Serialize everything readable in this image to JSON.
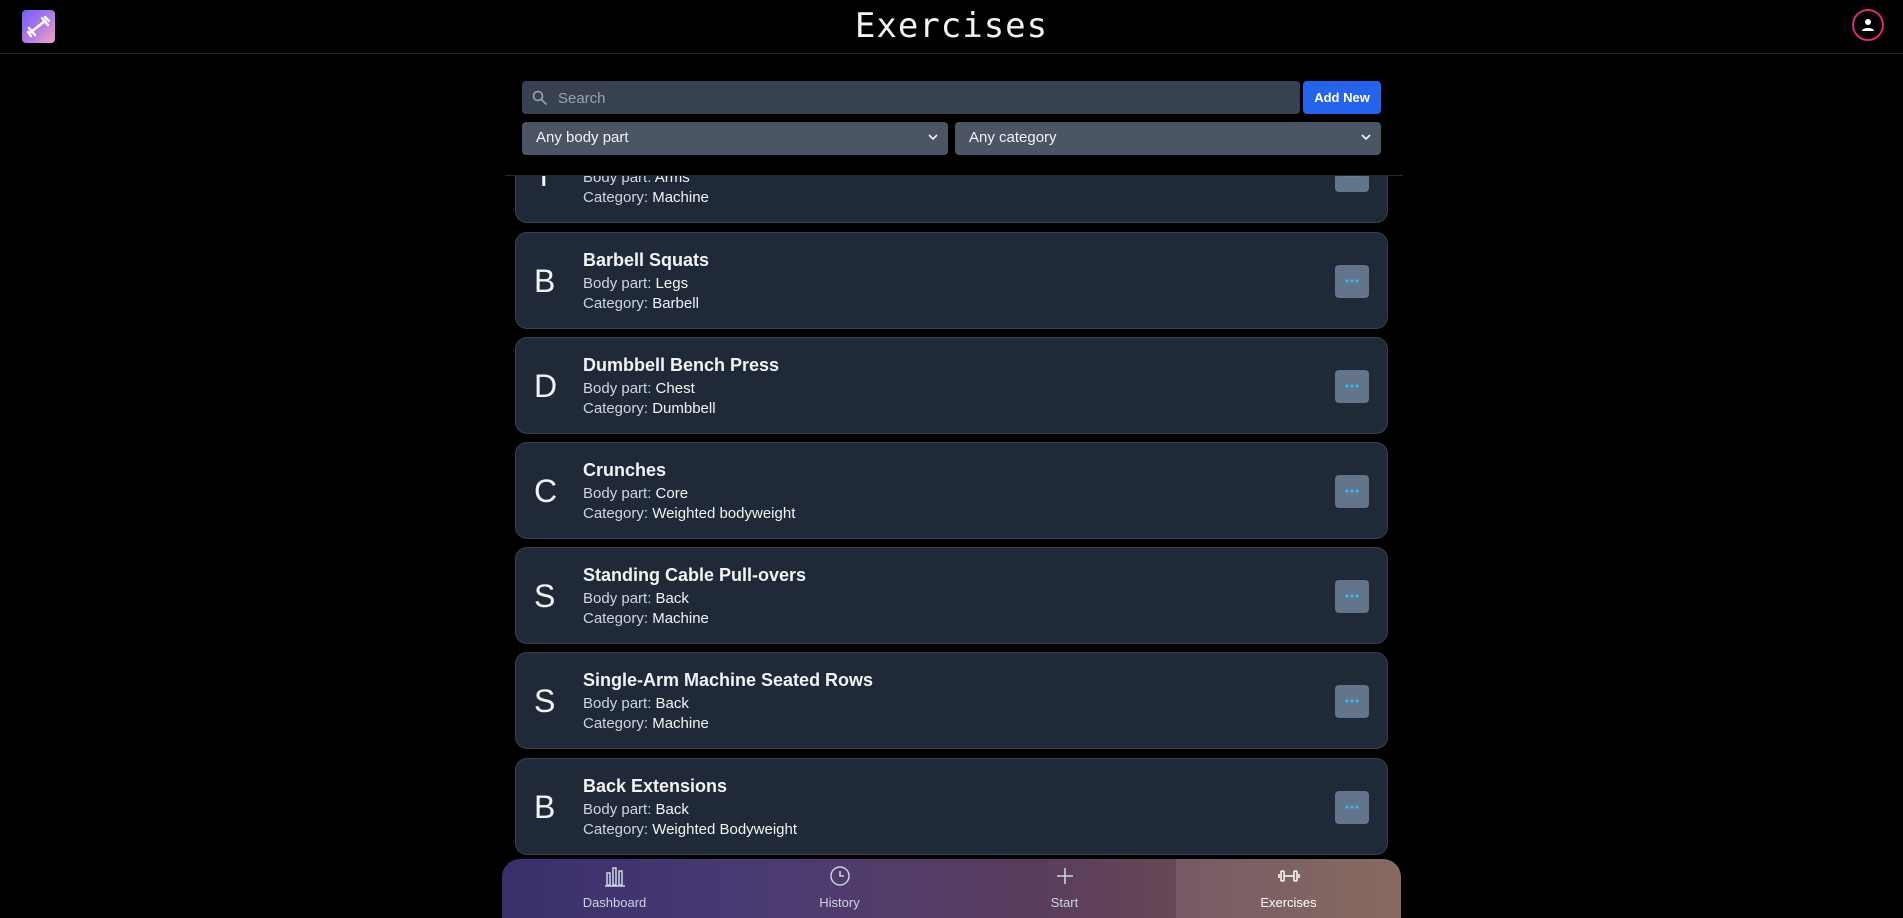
{
  "header": {
    "title": "Exercises"
  },
  "filters": {
    "search_placeholder": "Search",
    "add_label": "Add New",
    "body_part": "Any body part",
    "category": "Any category"
  },
  "labels": {
    "body_part": "Body part: ",
    "category": "Category: "
  },
  "exercises": [
    {
      "letter": "T",
      "name": "",
      "body_part": "Arms",
      "category": "Machine"
    },
    {
      "letter": "B",
      "name": "Barbell Squats",
      "body_part": "Legs",
      "category": "Barbell"
    },
    {
      "letter": "D",
      "name": "Dumbbell Bench Press",
      "body_part": "Chest",
      "category": "Dumbbell"
    },
    {
      "letter": "C",
      "name": "Crunches",
      "body_part": "Core",
      "category": "Weighted bodyweight"
    },
    {
      "letter": "S",
      "name": "Standing Cable Pull-overs",
      "body_part": "Back",
      "category": "Machine"
    },
    {
      "letter": "S",
      "name": "Single-Arm Machine Seated Rows",
      "body_part": "Back",
      "category": "Machine"
    },
    {
      "letter": "B",
      "name": "Back Extensions",
      "body_part": "Back",
      "category": "Weighted Bodyweight"
    }
  ],
  "nav": [
    {
      "label": "Dashboard",
      "icon": "bar-chart-icon"
    },
    {
      "label": "History",
      "icon": "clock-icon"
    },
    {
      "label": "Start",
      "icon": "plus-icon"
    },
    {
      "label": "Exercises",
      "icon": "dumbbell-icon",
      "active": true
    }
  ],
  "colors": {
    "accent": "#2563eb",
    "avatar_ring": "#db2777",
    "card_bg": "#1f2937"
  }
}
